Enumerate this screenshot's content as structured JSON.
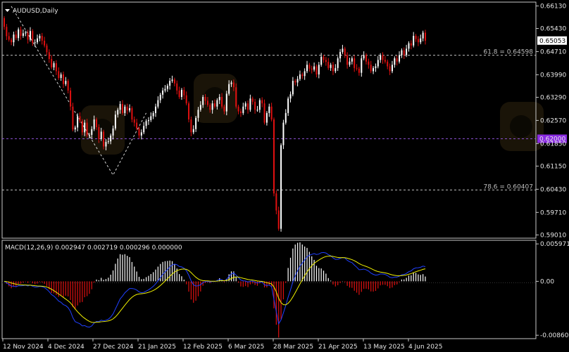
{
  "chart_data": [
    {
      "type": "candlestick",
      "title": "AUDUSD,Daily",
      "current_price": "0.65053",
      "y_ticks": [
        "0.66130",
        "0.65430",
        "0.64710",
        "0.63990",
        "0.63290",
        "0.62570",
        "0.61850",
        "0.61150",
        "0.60430",
        "0.59710",
        "0.59010"
      ],
      "ylim": [
        0.5893,
        0.6614
      ],
      "x_ticks": [
        "12 Nov 2024",
        "4 Dec 2024",
        "27 Dec 2024",
        "21 Jan 2025",
        "12 Feb 2025",
        "6 Mar 2025",
        "28 Mar 2025",
        "21 Apr 2025",
        "13 May 2025",
        "4 Jun 2025"
      ],
      "horizontal_lines": [
        {
          "label": "61.8 = 0.64598",
          "value": 0.64598,
          "color": "#bfbfbf"
        },
        {
          "label": "0.62000",
          "value": 0.62,
          "color": "#8a4fd0",
          "badge_color": "#8a2be2"
        },
        {
          "label": "78.6 = 0.60407",
          "value": 0.60407,
          "color": "#bfbfbf"
        }
      ],
      "fib_line": {
        "from": {
          "date": "12 Nov 2024",
          "value": 0.6612
        },
        "to": {
          "date": "21 Jan 2025",
          "value": 0.6087
        },
        "to2": {
          "date": "12 Feb 2025",
          "value": 0.628
        }
      },
      "colors": {
        "bull": "#ffffff",
        "bear": "#e01010",
        "background": "#000000"
      },
      "closes": [
        0.6548,
        0.6519,
        0.6508,
        0.65,
        0.6524,
        0.6513,
        0.654,
        0.652,
        0.6528,
        0.653,
        0.6508,
        0.6535,
        0.6498,
        0.65,
        0.6512,
        0.652,
        0.6505,
        0.649,
        0.6469,
        0.6448,
        0.6422,
        0.6435,
        0.641,
        0.6389,
        0.64,
        0.637,
        0.638,
        0.635,
        0.63,
        0.6229,
        0.6235,
        0.627,
        0.6255,
        0.622,
        0.625,
        0.621,
        0.6212,
        0.623,
        0.626,
        0.6236,
        0.6199,
        0.6222,
        0.6176,
        0.619,
        0.6192,
        0.621,
        0.6232,
        0.6275,
        0.629,
        0.6308,
        0.628,
        0.63,
        0.6288,
        0.6295,
        0.626,
        0.625,
        0.6232,
        0.621,
        0.622,
        0.624,
        0.6255,
        0.6258,
        0.627,
        0.628,
        0.63,
        0.632,
        0.6337,
        0.635,
        0.6355,
        0.6365,
        0.638,
        0.6384,
        0.6372,
        0.635,
        0.633,
        0.6352,
        0.6335,
        0.631,
        0.626,
        0.622,
        0.623,
        0.6265,
        0.629,
        0.6305,
        0.633,
        0.6318,
        0.6305,
        0.629,
        0.631,
        0.63,
        0.632,
        0.633,
        0.63,
        0.6285,
        0.634,
        0.637,
        0.6375,
        0.636,
        0.63,
        0.6285,
        0.628,
        0.63,
        0.631,
        0.629,
        0.6325,
        0.6315,
        0.629,
        0.629,
        0.632,
        0.631,
        0.625,
        0.628,
        0.63,
        0.626,
        0.603,
        0.5977,
        0.592,
        0.618,
        0.625,
        0.628,
        0.6325,
        0.6338,
        0.638,
        0.6375,
        0.6386,
        0.64,
        0.6395,
        0.641,
        0.643,
        0.6418,
        0.6415,
        0.6425,
        0.64,
        0.643,
        0.6455,
        0.6445,
        0.6439,
        0.642,
        0.643,
        0.641,
        0.642,
        0.645,
        0.647,
        0.648,
        0.646,
        0.643,
        0.644,
        0.645,
        0.642,
        0.6418,
        0.6405,
        0.645,
        0.646,
        0.644,
        0.643,
        0.641,
        0.642,
        0.6425,
        0.6445,
        0.646,
        0.6445,
        0.644,
        0.6425,
        0.641,
        0.643,
        0.645,
        0.644,
        0.646,
        0.6475,
        0.646,
        0.648,
        0.6497,
        0.649,
        0.652,
        0.651,
        0.65,
        0.6512,
        0.653,
        0.6505
      ]
    },
    {
      "type": "macd",
      "title": "MACD(12,26,9) 0.002947 0.002719 0.000296 0.000000",
      "y_ticks": [
        "0.005971",
        "0.00",
        "-0.008607"
      ],
      "ylim": [
        -0.0087,
        0.0061
      ],
      "colors": {
        "histogram_pos": "#ffffff",
        "histogram_neg": "#e01010",
        "macd_line": "#2040ff",
        "signal_line": "#f0f000"
      }
    }
  ]
}
